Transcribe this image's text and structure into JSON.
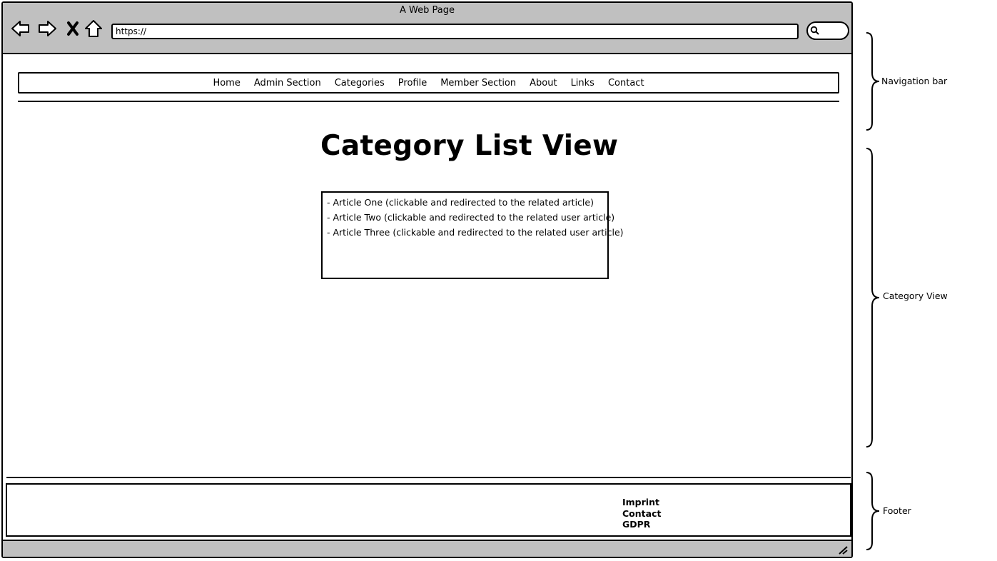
{
  "window": {
    "title": "A Web Page",
    "url": "https://"
  },
  "toolbar": {
    "icons": [
      "back-arrow-icon",
      "forward-arrow-icon",
      "close-x-icon",
      "home-icon",
      "search-icon"
    ]
  },
  "navbar": {
    "items": [
      "Home",
      "Admin Section",
      "Categories",
      "Profile",
      "Member Section",
      "About",
      "Links",
      "Contact"
    ]
  },
  "main": {
    "title": "Category List View",
    "articles": [
      "- Article One (clickable and redirected to the related article)",
      "- Article Two (clickable and redirected to the related user article)",
      "- Article Three (clickable and redirected to the related user article)"
    ]
  },
  "footer": {
    "links": [
      "Imprint",
      "Contact",
      "GDPR"
    ]
  },
  "annotations": {
    "navigation": "Navigation bar",
    "category_view": "Category View",
    "footer": "Footer"
  },
  "colors": {
    "chrome": "#c0c0c0",
    "border": "#000000",
    "background": "#ffffff"
  }
}
